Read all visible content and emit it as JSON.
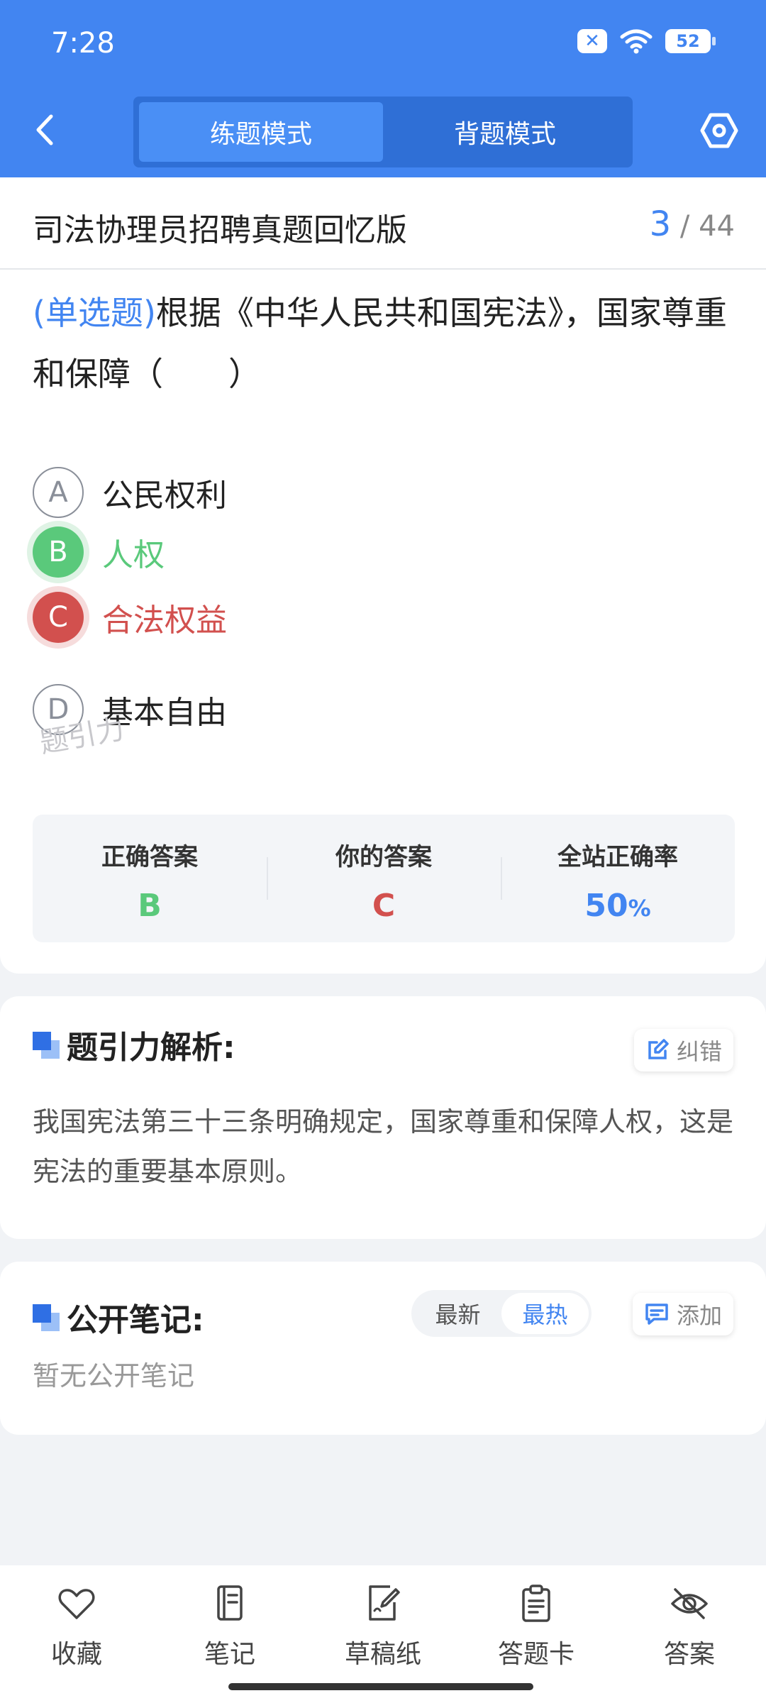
{
  "status_bar": {
    "time": "7:28",
    "battery": "52"
  },
  "header": {
    "tabs": [
      {
        "label": "练题模式",
        "active": true
      },
      {
        "label": "背题模式",
        "active": false
      }
    ]
  },
  "question": {
    "paper_title": "司法协理员招聘真题回忆版",
    "current": "3",
    "total": "/ 44",
    "type_label": "(单选题)",
    "text": "根据《中华人民共和国宪法》，国家尊重和保障（　　）",
    "options": [
      {
        "letter": "A",
        "text": "公民权利",
        "state": "normal"
      },
      {
        "letter": "B",
        "text": "人权",
        "state": "correct"
      },
      {
        "letter": "C",
        "text": "合法权益",
        "state": "wrong"
      },
      {
        "letter": "D",
        "text": "基本自由",
        "state": "normal"
      }
    ],
    "answer_summary": {
      "correct_title": "正确答案",
      "correct_value": "B",
      "yours_title": "你的答案",
      "yours_value": "C",
      "rate_title": "全站正确率",
      "rate_value": "50",
      "rate_unit": "%"
    },
    "watermark": "题引力"
  },
  "analysis": {
    "title": "题引力解析:",
    "report_label": "纠错",
    "text": "我国宪法第三十三条明确规定，国家尊重和保障人权，这是宪法的重要基本原则。"
  },
  "notes": {
    "title": "公开笔记:",
    "sort_options": [
      {
        "label": "最新",
        "active": false
      },
      {
        "label": "最热",
        "active": true
      }
    ],
    "add_label": "添加",
    "empty_text": "暂无公开笔记"
  },
  "bottom_nav": [
    {
      "label": "收藏",
      "icon": "heart-icon"
    },
    {
      "label": "笔记",
      "icon": "notebook-icon"
    },
    {
      "label": "草稿纸",
      "icon": "draft-paper-icon"
    },
    {
      "label": "答题卡",
      "icon": "answer-sheet-icon"
    },
    {
      "label": "答案",
      "icon": "eye-off-icon"
    }
  ],
  "colors": {
    "primary": "#4285f1",
    "correct": "#5ac97b",
    "wrong": "#d2504e"
  }
}
